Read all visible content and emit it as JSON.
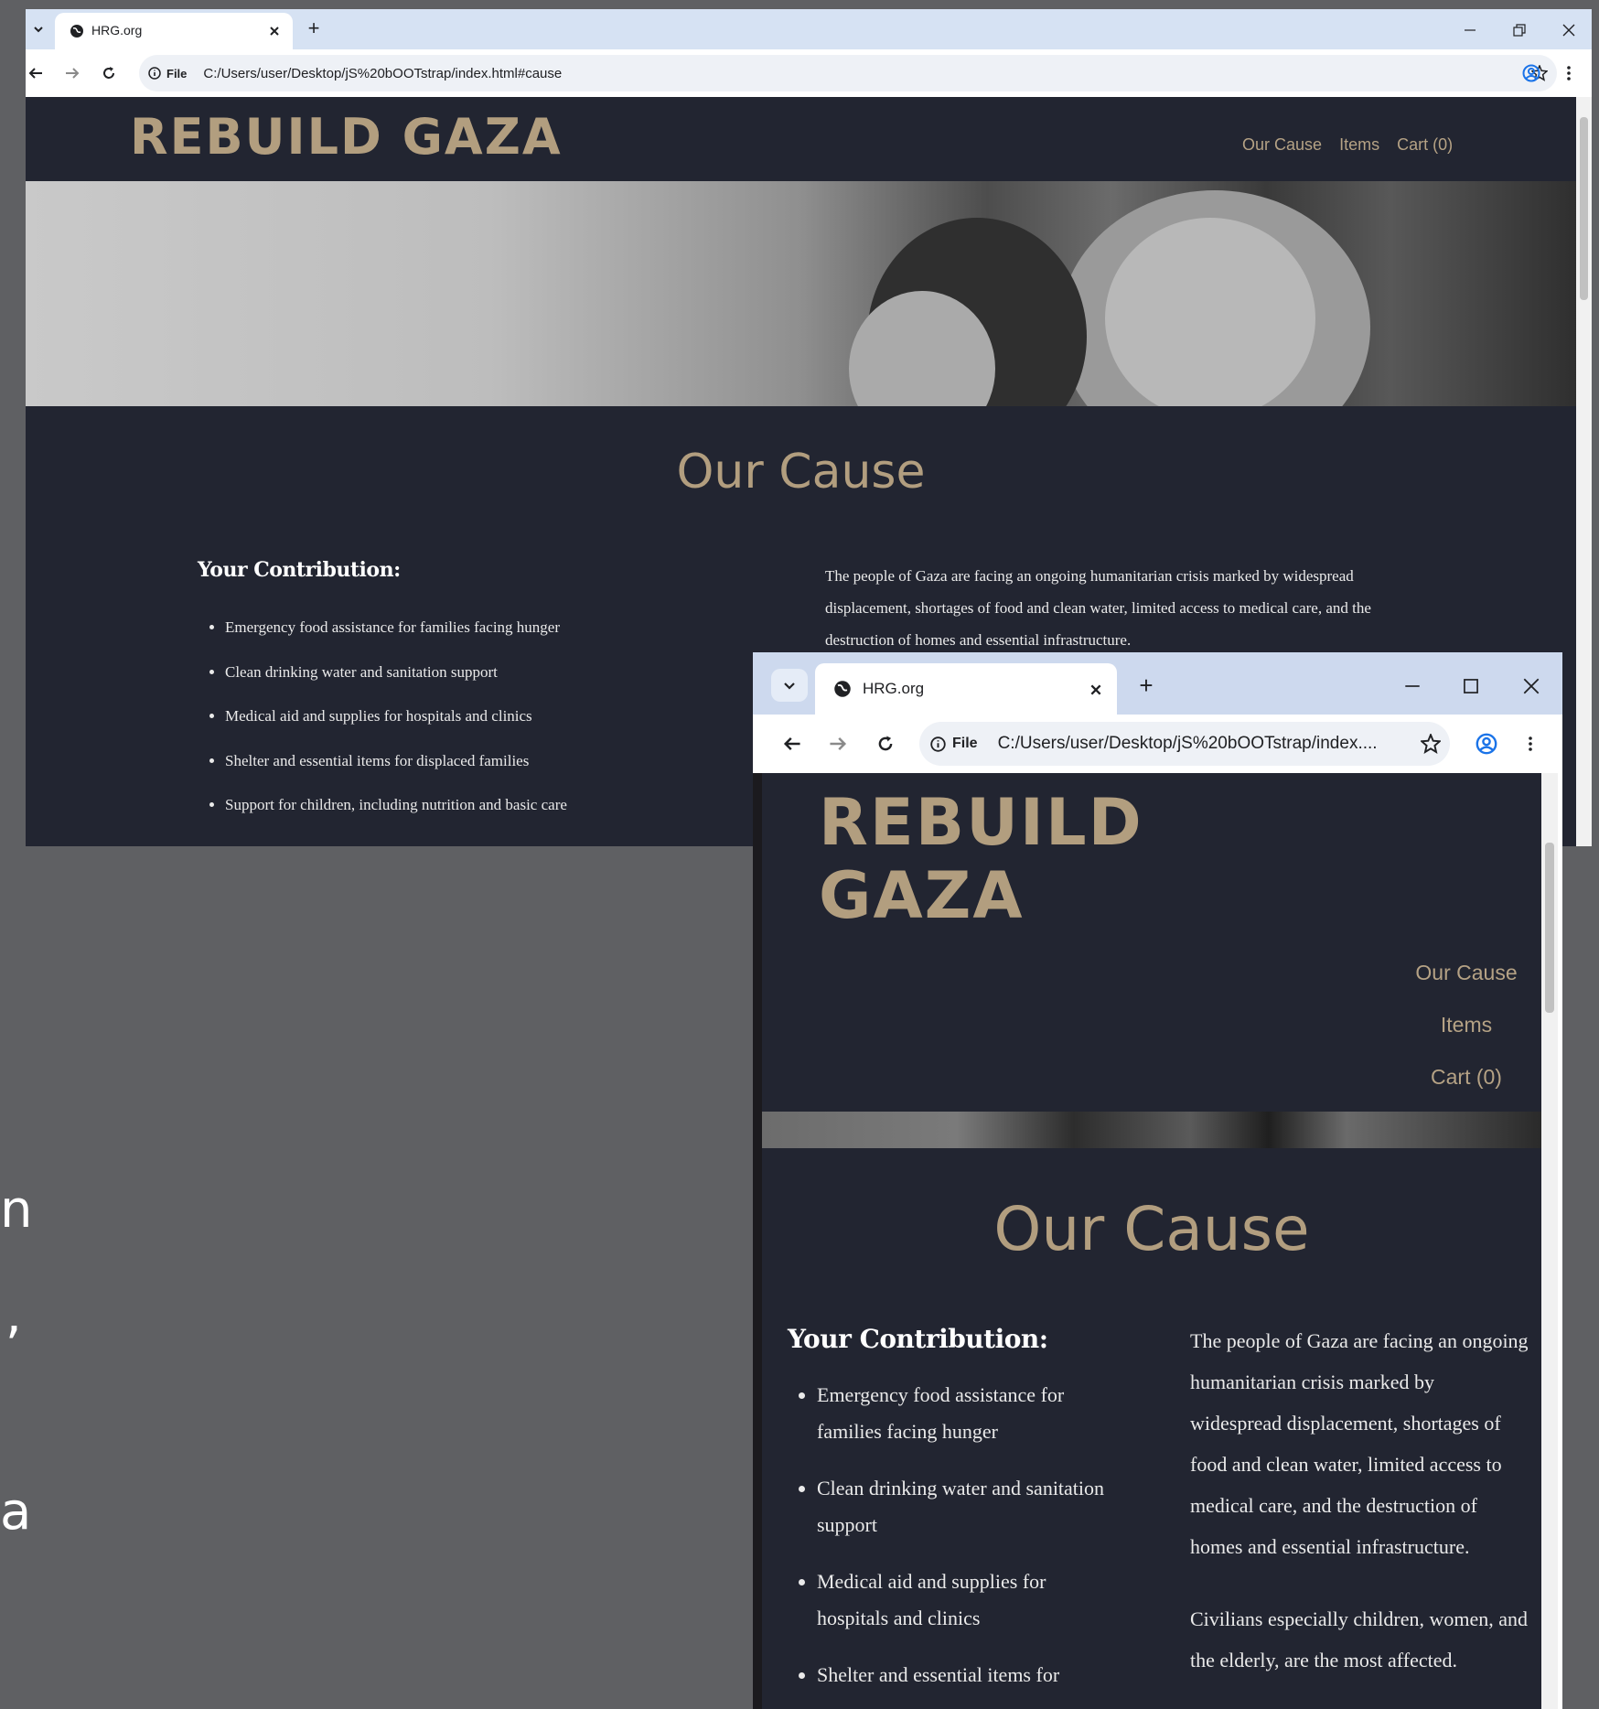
{
  "browser": {
    "tab_title": "HRG.org",
    "new_tab_label": "+",
    "site_info_label": "File",
    "url_full": "C:/Users/user/Desktop/jS%20bOOTstrap/index.html#cause",
    "url_truncated": "C:/Users/user/Desktop/jS%20bOOTstrap/index...."
  },
  "site": {
    "logo": "REBUILD GAZA",
    "logo_line1": "REBUILD",
    "logo_line2": "GAZA",
    "nav": [
      "Our Cause",
      "Items",
      "Cart (0)"
    ],
    "section_title": "Our Cause",
    "contribution_heading": "Your Contribution:",
    "contributions": [
      "Emergency food assistance for families facing hunger",
      "Clean drinking water and sanitation support",
      "Medical aid and supplies for hospitals and clinics",
      "Shelter and essential items for displaced families",
      "Support for children, including nutrition and basic care"
    ],
    "contributions_small_visible": [
      "Emergency food assistance for families facing hunger",
      "Clean drinking water and sanitation support",
      "Medical aid and supplies for hospitals and clinics",
      "Shelter and essential items for"
    ],
    "paragraph1": "The people of Gaza are facing an ongoing humanitarian crisis marked by widespread displacement, shortages of food and clean water, limited access to medical care, and the destruction of homes and essential infrastructure.",
    "paragraph2": "Civilians especially children, women, and the elderly, are the most affected."
  },
  "background_fragments": [
    "n",
    ",",
    "a"
  ],
  "colors": {
    "page_bg": "#222531",
    "accent": "#b29e7f",
    "tabbar": "#d6e2f3",
    "desktop": "#5f6063"
  }
}
